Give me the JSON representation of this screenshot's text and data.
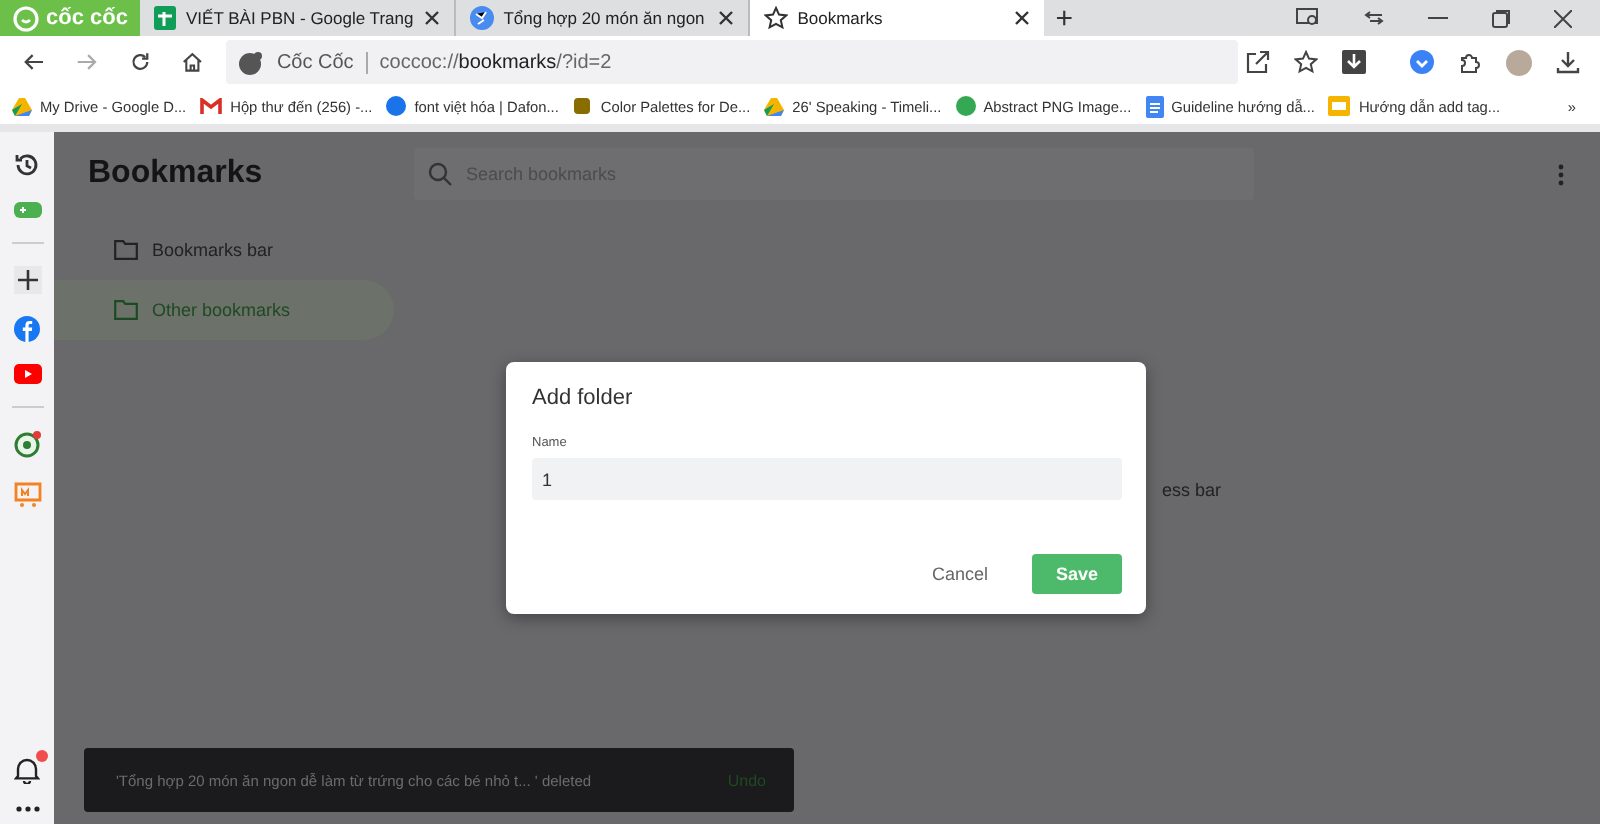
{
  "browser": {
    "logo": "cốc cốc",
    "tabs": [
      {
        "title": "VIẾT BÀI PBN - Google Trang",
        "selected": false
      },
      {
        "title": "Tổng hợp 20 món ăn ngon",
        "selected": false
      },
      {
        "title": "Bookmarks",
        "selected": true
      }
    ],
    "new_tab": "+",
    "address": {
      "site": "Cốc Cốc",
      "url_prefix": "coccoc://",
      "url_host": "bookmarks",
      "url_rest": "/?id=2"
    },
    "bookmarks_bar": [
      {
        "label": "My Drive - Google D..."
      },
      {
        "label": "Hộp thư đến (256) -..."
      },
      {
        "label": "font việt hóa | Dafon..."
      },
      {
        "label": "Color Palettes for De..."
      },
      {
        "label": "26' Speaking - Timeli..."
      },
      {
        "label": "Abstract PNG Image..."
      },
      {
        "label": "Guideline hướng dẫ..."
      },
      {
        "label": "Hướng dẫn add tag..."
      }
    ],
    "more": "»"
  },
  "sidebar": {
    "notification_badge": true
  },
  "page": {
    "title": "Bookmarks",
    "search": {
      "placeholder": "Search bookmarks"
    },
    "folders": [
      {
        "label": "Bookmarks bar",
        "selected": false
      },
      {
        "label": "Other bookmarks",
        "selected": true
      }
    ],
    "behind_text": "ess bar"
  },
  "dialog": {
    "title": "Add folder",
    "field_label": "Name",
    "value": "1",
    "buttons": [
      {
        "label": "Cancel",
        "kind": "text"
      },
      {
        "label": "Save",
        "kind": "primary"
      }
    ]
  },
  "toast": {
    "message": "'Tổng hợp 20 món ăn ngon dễ làm từ trứng cho các bé nhỏ t... ' deleted",
    "action": "Undo"
  }
}
